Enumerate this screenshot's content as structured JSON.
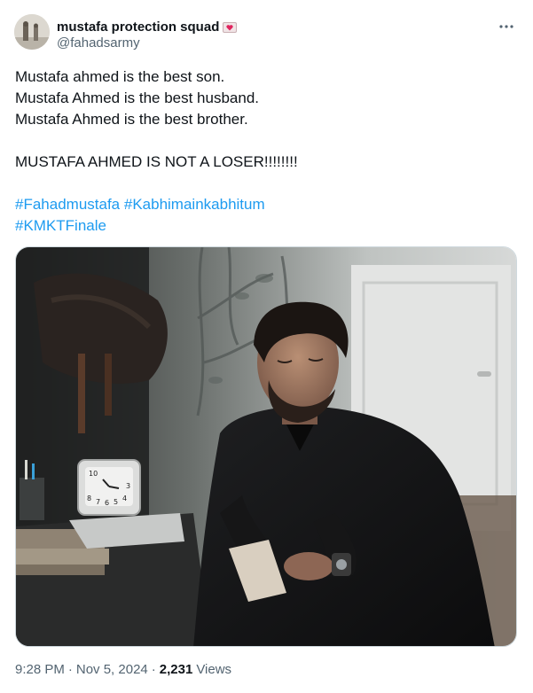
{
  "author": {
    "display_name": "mustafa protection squad",
    "handle": "@fahadsarmy",
    "name_emoji": "heart-letter-icon"
  },
  "tweet": {
    "lines": [
      "Mustafa ahmed is the best son.",
      "Mustafa Ahmed is the best husband.",
      "Mustafa Ahmed is the best brother."
    ],
    "shout": "MUSTAFA AHMED IS NOT A LOSER!!!!!!!!",
    "hashtags": [
      "#Fahadmustafa",
      "#Kabhimainkabhitum",
      "#KMKTFinale"
    ]
  },
  "media": {
    "clock_numbers": [
      "10",
      "3",
      "8",
      "7",
      "6",
      "5",
      "4"
    ]
  },
  "meta": {
    "time": "9:28 PM",
    "date": "Nov 5, 2024",
    "separator": "·",
    "views_count": "2,231",
    "views_label": "Views"
  },
  "colors": {
    "link": "#1d9bf0",
    "secondary_text": "#536471",
    "primary_text": "#0f1419"
  }
}
